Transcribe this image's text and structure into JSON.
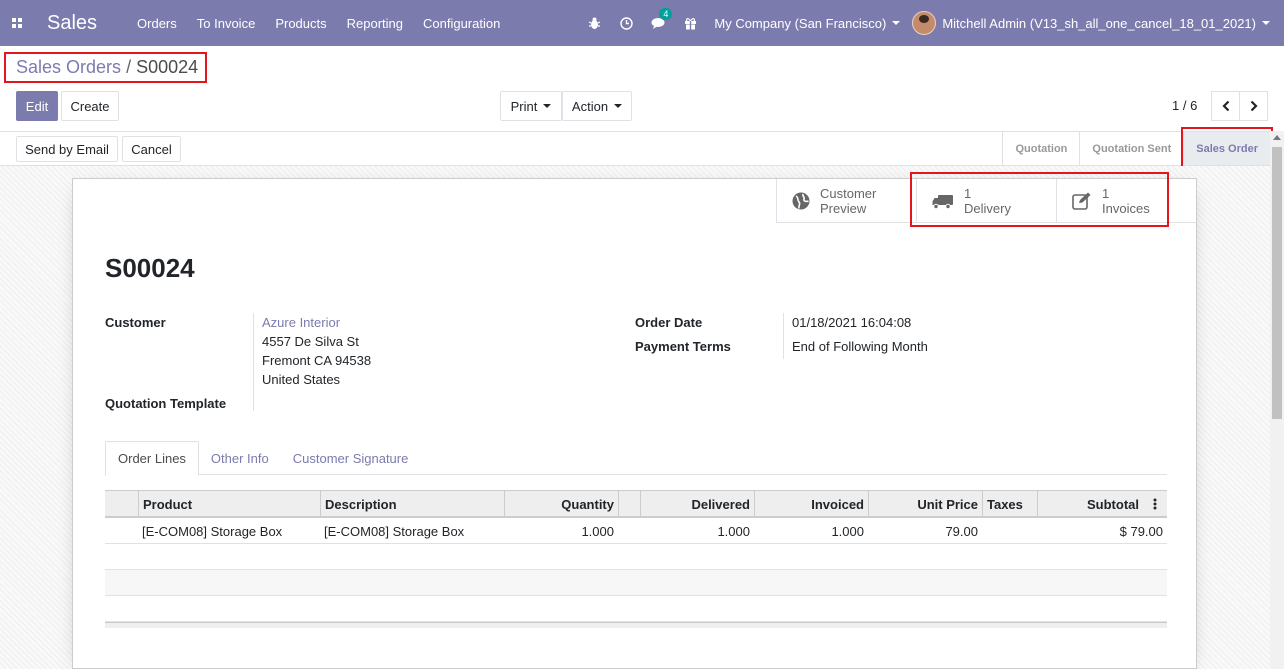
{
  "navbar": {
    "app_name": "Sales",
    "menu": [
      "Orders",
      "To Invoice",
      "Products",
      "Reporting",
      "Configuration"
    ],
    "messages_count": "4",
    "company": "My Company (San Francisco)",
    "user": "Mitchell Admin (V13_sh_all_one_cancel_18_01_2021)"
  },
  "breadcrumb": {
    "parent": "Sales Orders",
    "separator": "/",
    "current": "S00024"
  },
  "controls": {
    "edit": "Edit",
    "create": "Create",
    "print": "Print",
    "action": "Action",
    "pager": "1 / 6"
  },
  "statusbar": {
    "buttons": [
      "Send by Email",
      "Cancel"
    ],
    "steps": [
      "Quotation",
      "Quotation Sent",
      "Sales Order"
    ],
    "active_step": "Sales Order"
  },
  "smart_buttons": {
    "preview": {
      "line1": "Customer",
      "line2": "Preview"
    },
    "delivery": {
      "count": "1",
      "label": "Delivery"
    },
    "invoices": {
      "count": "1",
      "label": "Invoices"
    }
  },
  "form": {
    "name": "S00024",
    "customer_label": "Customer",
    "customer_name": "Azure Interior",
    "address": [
      "4557 De Silva St",
      "Fremont CA 94538",
      "United States"
    ],
    "template_label": "Quotation Template",
    "order_date_label": "Order Date",
    "order_date": "01/18/2021 16:04:08",
    "payment_terms_label": "Payment Terms",
    "payment_terms": "End of Following Month"
  },
  "tabs": [
    "Order Lines",
    "Other Info",
    "Customer Signature"
  ],
  "table": {
    "headers": [
      "Product",
      "Description",
      "Quantity",
      "Delivered",
      "Invoiced",
      "Unit Price",
      "Taxes",
      "Subtotal"
    ],
    "rows": [
      {
        "product": "[E-COM08] Storage Box",
        "description": "[E-COM08] Storage Box",
        "quantity": "1.000",
        "delivered": "1.000",
        "invoiced": "1.000",
        "unit_price": "79.00",
        "taxes": "",
        "subtotal": "$ 79.00"
      }
    ]
  },
  "colors": {
    "brand": "#7c7bad",
    "highlight": "#e2171e"
  },
  "icons": [
    "apps-icon",
    "bug-icon",
    "clock-icon",
    "chat-icon",
    "gift-icon",
    "globe-icon",
    "truck-icon",
    "edit-icon",
    "chevron-left-icon",
    "chevron-right-icon",
    "kebab-icon"
  ]
}
